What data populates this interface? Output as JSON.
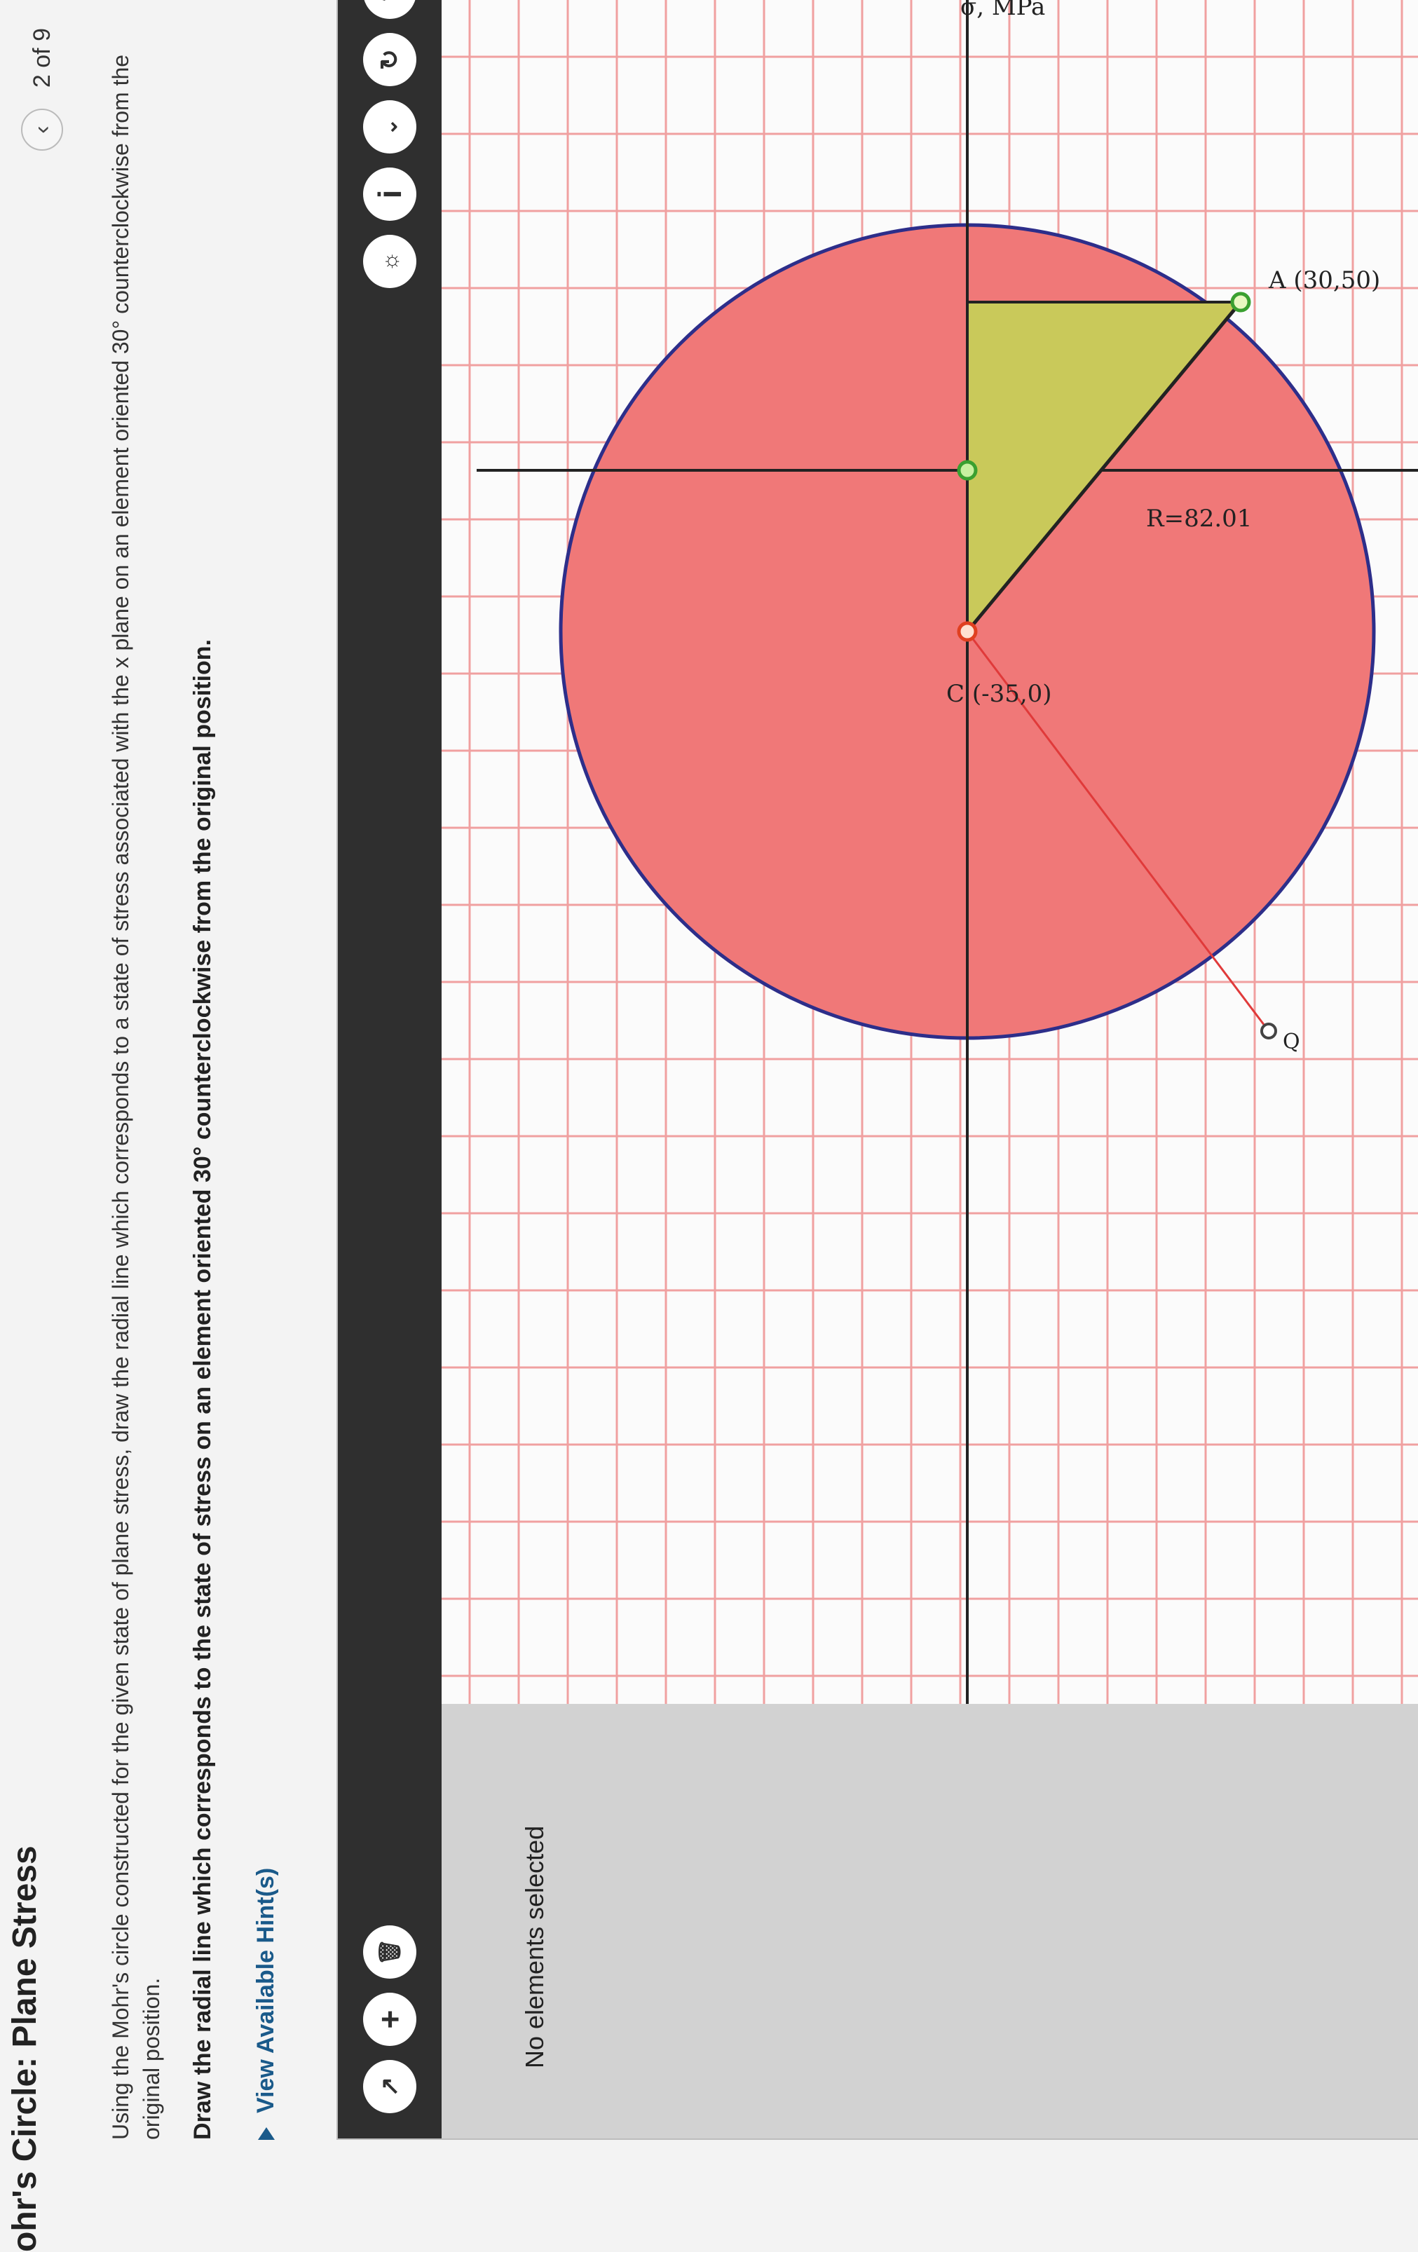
{
  "header": {
    "title": "ohr's Circle: Plane Stress",
    "pager_text": "2 of 9",
    "prev_icon": "chevron-left-icon"
  },
  "question": {
    "text": "Using the Mohr's circle constructed for the given state of plane stress, draw the radial line which corresponds to a state of stress associated with the x plane on an element oriented 30° counterclockwise from the original position.",
    "instruction": "Draw the radial line which corresponds to the state of stress on an element oriented 30° counterclockwise from the original position.",
    "hint_link": "View Available Hint(s)"
  },
  "tool": {
    "status_text": "No elements selected",
    "left_buttons": [
      "add-vector-icon",
      "plus-icon",
      "delete-icon"
    ],
    "right_buttons": [
      "hint-bulb-icon",
      "info-icon",
      "chevron-down-icon",
      "reset-icon",
      "help-icon"
    ]
  },
  "plot": {
    "axis_label_sigma": "σ, MPa",
    "center_label": "C (-35,0)",
    "radius_label": "R=82.01",
    "point_a_label": "A (30,50)",
    "point_q_label": "Q",
    "colors": {
      "circle_fill": "#f07878",
      "circle_stroke": "#2d2e8a",
      "triangle_fill": "#c9c95a",
      "grid": "#f0a0a0",
      "radial_line": "#e03a3a"
    }
  }
}
